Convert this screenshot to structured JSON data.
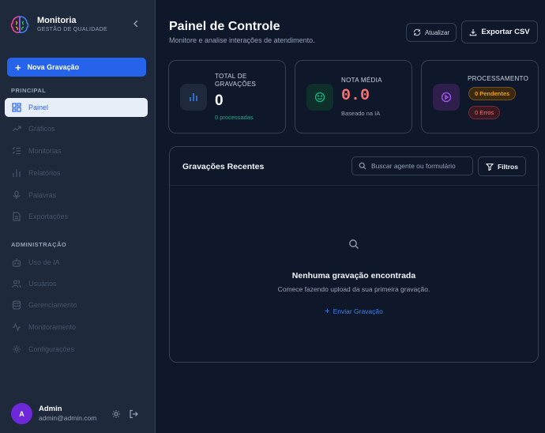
{
  "brand": {
    "name": "Monitoria",
    "subtitle": "GESTÃO DE QUALIDADE"
  },
  "sidebar": {
    "new_button": "Nova Gravação",
    "section_principal": "PRINCIPAL",
    "section_admin": "ADMINISTRAÇÃO",
    "items": [
      {
        "label": "Painel",
        "icon": "grid-icon",
        "active": true
      },
      {
        "label": "Gráficos",
        "icon": "trend-icon"
      },
      {
        "label": "Monitorias",
        "icon": "checklist-icon"
      },
      {
        "label": "Relatórios",
        "icon": "bar-chart-icon"
      },
      {
        "label": "Palavras",
        "icon": "mic-icon"
      },
      {
        "label": "Exportações",
        "icon": "file-icon"
      }
    ],
    "admin_items": [
      {
        "label": "Uso de IA",
        "icon": "bot-icon"
      },
      {
        "label": "Usuários",
        "icon": "users-icon"
      },
      {
        "label": "Gerenciamento",
        "icon": "database-icon"
      },
      {
        "label": "Monitoramento",
        "icon": "activity-icon"
      },
      {
        "label": "Configurações",
        "icon": "gear-icon"
      }
    ]
  },
  "user": {
    "initial": "A",
    "name": "Admin",
    "email": "admin@admin.com"
  },
  "header": {
    "title": "Painel de Controle",
    "subtitle": "Monitore e analise interações de atendimento.",
    "update_label": "Atualizar",
    "export_label": "Exportar CSV"
  },
  "cards": {
    "total": {
      "label": "TOTAL DE GRAVAÇÕES",
      "value": "0",
      "note": "0 processadas"
    },
    "score": {
      "label": "NOTA MÉDIA",
      "value": "0.0",
      "note": "Baseado na IA"
    },
    "processing": {
      "label": "PROCESSAMENTO",
      "pending": "0 Pendentes",
      "errors": "0 Erros"
    }
  },
  "recent": {
    "title": "Gravações Recentes",
    "search_placeholder": "Buscar agente ou formulário",
    "filter_label": "Filtros",
    "empty_title": "Nenhuma gravação encontrada",
    "empty_subtitle": "Comece fazendo upload da sua primeira gravação.",
    "empty_action": "Enviar Gravação"
  },
  "colors": {
    "accent": "#2563eb",
    "score": "#f87171",
    "success": "#10b981",
    "pending": "#f59e0b",
    "error": "#f87171"
  }
}
